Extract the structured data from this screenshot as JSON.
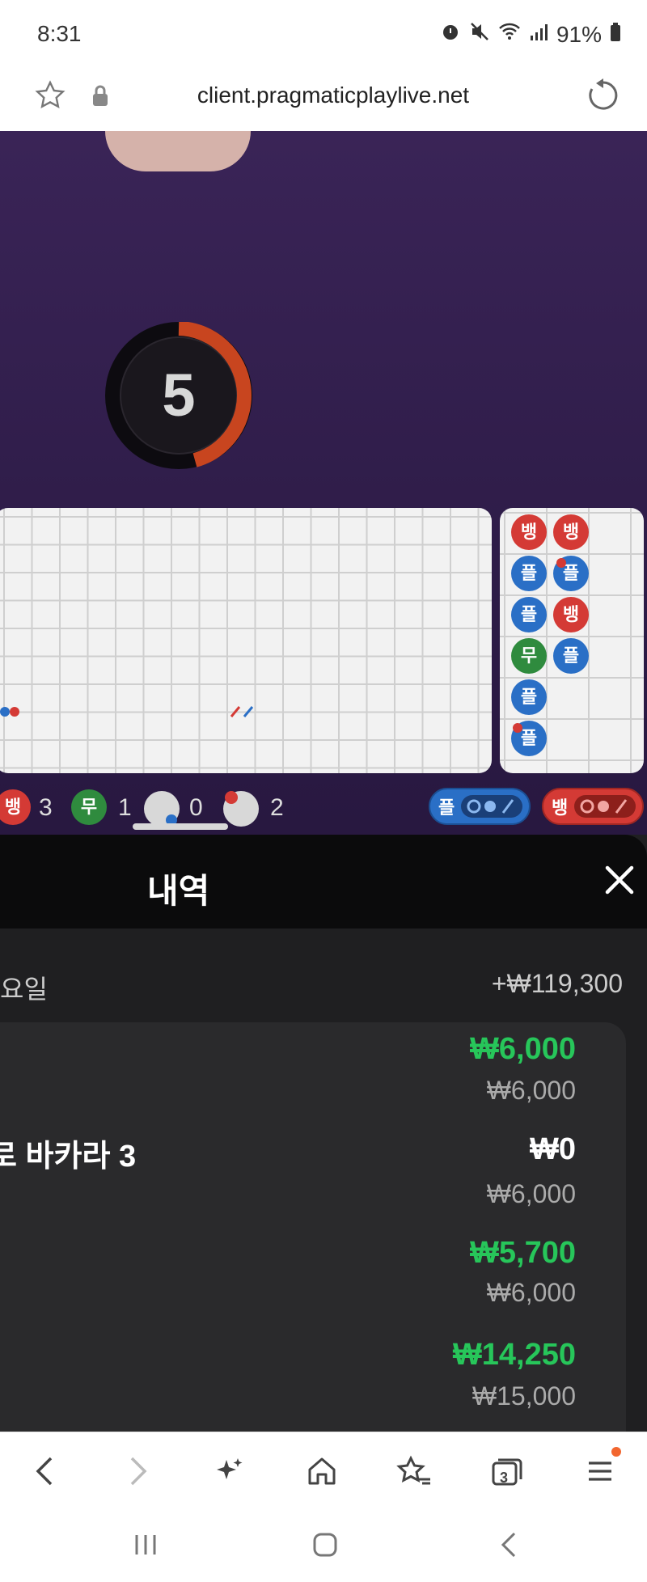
{
  "status_bar": {
    "time": "8:31",
    "battery": "91%"
  },
  "browser": {
    "url": "client.pragmaticplaylive.net",
    "tab_count": "3"
  },
  "game": {
    "countdown": "5",
    "bead_road": [
      {
        "label": "뱅",
        "color": "red"
      },
      {
        "label": "뱅",
        "color": "red"
      },
      {
        "label": "플",
        "color": "blue"
      },
      {
        "label": "플",
        "color": "blue"
      },
      {
        "label": "플",
        "color": "blue"
      },
      {
        "label": "뱅",
        "color": "red"
      },
      {
        "label": "무",
        "color": "green"
      },
      {
        "label": "플",
        "color": "blue"
      },
      {
        "label": "플",
        "color": "blue"
      },
      {
        "label": "플",
        "color": "blue"
      }
    ],
    "stats": {
      "banker_label": "뱅",
      "banker_count": "3",
      "tie_label": "무",
      "tie_count": "1",
      "player_pair_count": "0",
      "banker_pair_count": "2"
    },
    "predict": {
      "player_label": "플",
      "banker_label": "뱅"
    }
  },
  "history_panel": {
    "title": "내역",
    "day_label": "요일",
    "day_total": "+₩119,300",
    "game_name": "바카라 3",
    "game_name_prefix": "로",
    "entries": [
      {
        "win": "₩6,000",
        "bet": "₩6,000",
        "win_color": "green"
      },
      {
        "win": "₩0",
        "bet": "₩6,000",
        "win_color": "white"
      },
      {
        "win": "₩5,700",
        "bet": "₩6,000",
        "win_color": "green"
      },
      {
        "win": "₩14,250",
        "bet": "₩15,000",
        "win_color": "green"
      }
    ]
  },
  "colors": {
    "accent_green": "#27c65a",
    "banker_red": "#d43a35",
    "player_blue": "#2a6fc6",
    "tie_green": "#2f8b3e"
  }
}
